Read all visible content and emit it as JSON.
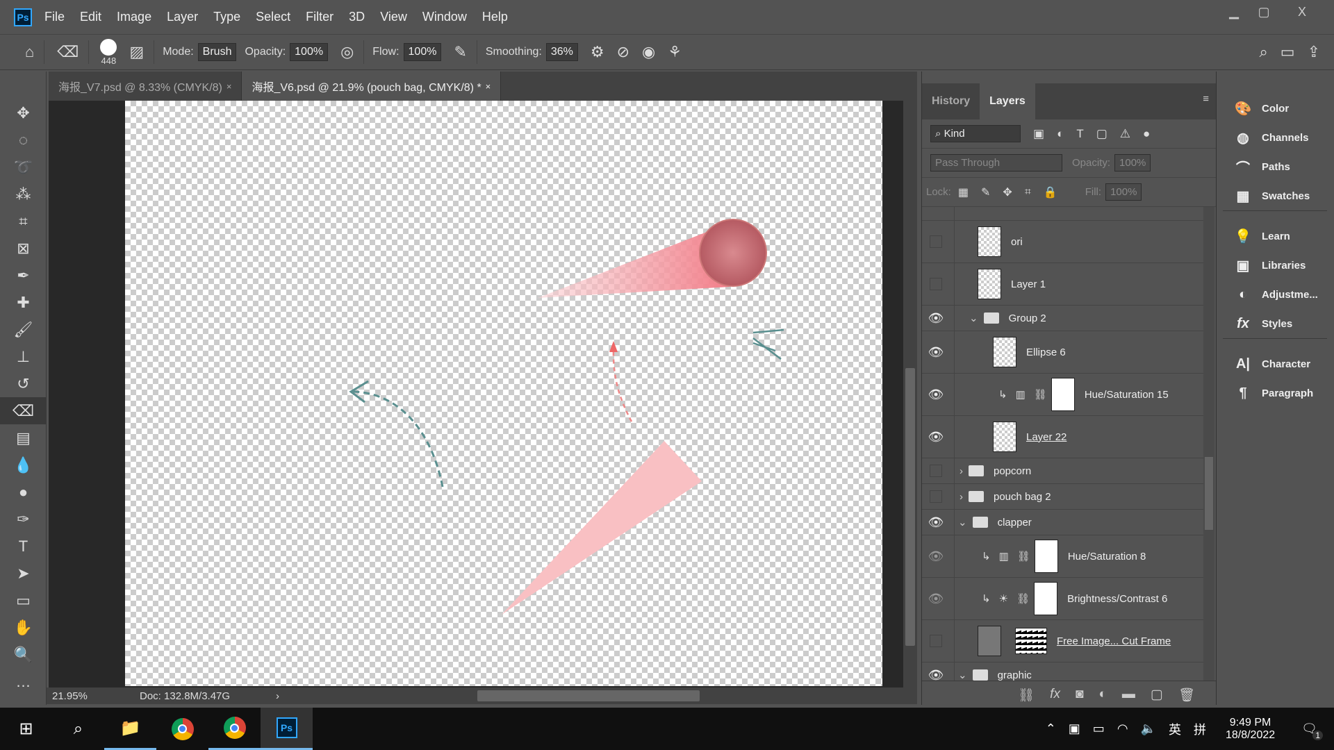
{
  "menu": [
    "File",
    "Edit",
    "Image",
    "Layer",
    "Type",
    "Select",
    "Filter",
    "3D",
    "View",
    "Window",
    "Help"
  ],
  "app_logo": "Ps",
  "window_controls": {
    "minimize": "▁",
    "maximize": "▢",
    "close": "X"
  },
  "options": {
    "brush_size": "448",
    "mode_label": "Mode:",
    "mode": "Brush",
    "opacity_label": "Opacity:",
    "opacity": "100%",
    "flow_label": "Flow:",
    "flow": "100%",
    "smoothing_label": "Smoothing:",
    "smoothing": "36%"
  },
  "tabs": [
    {
      "label": "海报_V7.psd @ 8.33% (CMYK/8)",
      "close": "×"
    },
    {
      "label": "海报_V6.psd @ 21.9% (pouch bag, CMYK/8) *",
      "close": "×"
    }
  ],
  "status": {
    "zoom": "21.95%",
    "doc": "Doc: 132.8M/3.47G"
  },
  "layers_panel": {
    "tabs": [
      "History",
      "Layers"
    ],
    "filter": "Kind",
    "blend_mode": "Pass Through",
    "opacity_label": "Opacity:",
    "opacity": "100%",
    "lock_label": "Lock:",
    "fill_label": "Fill:",
    "fill": "100%",
    "layers": [
      {
        "name": "ori",
        "visible": false
      },
      {
        "name": "Layer 1",
        "visible": false
      },
      {
        "name": "Group 2",
        "visible": true,
        "type": "group",
        "expanded": true
      },
      {
        "name": "Ellipse 6",
        "visible": true
      },
      {
        "name": "Hue/Saturation 15",
        "visible": true,
        "type": "adjustment"
      },
      {
        "name": "Layer 22",
        "visible": true
      },
      {
        "name": "popcorn",
        "visible": false,
        "type": "group"
      },
      {
        "name": "pouch bag 2",
        "visible": false,
        "type": "group"
      },
      {
        "name": "clapper",
        "visible": true,
        "type": "group",
        "expanded": true
      },
      {
        "name": "Hue/Saturation 8",
        "visible": true,
        "type": "adjustment"
      },
      {
        "name": "Brightness/Contrast 6",
        "visible": true,
        "type": "adjustment"
      },
      {
        "name": "Free Image... Cut Frame",
        "visible": false
      },
      {
        "name": "graphic",
        "visible": true,
        "type": "group"
      }
    ]
  },
  "dock": [
    "Color",
    "Channels",
    "Paths",
    "Swatches",
    "Learn",
    "Libraries",
    "Adjustme...",
    "Styles",
    "Character",
    "Paragraph"
  ],
  "taskbar": {
    "time": "9:49 PM",
    "date": "18/8/2022",
    "ime1": "英",
    "ime2": "拼",
    "notifications": "1"
  },
  "colors": {
    "accent": "#31a8ff",
    "pink": "#f7a5aa",
    "teal": "#5a8f8f"
  }
}
